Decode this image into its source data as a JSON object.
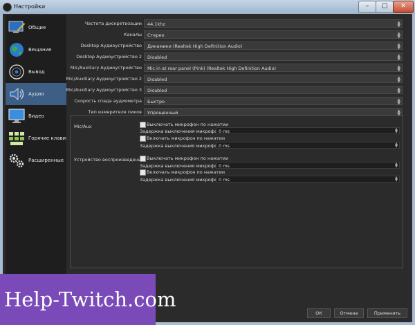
{
  "window": {
    "title": "Настройки",
    "minimize": "–",
    "maximize": "□",
    "close": "✕"
  },
  "sidebar": {
    "items": [
      {
        "label": "Общие",
        "icon": "monitor-pencil-icon"
      },
      {
        "label": "Вещание",
        "icon": "globe-icon"
      },
      {
        "label": "Вывод",
        "icon": "broadcast-icon"
      },
      {
        "label": "Аудио",
        "icon": "speaker-icon",
        "active": true
      },
      {
        "label": "Видео",
        "icon": "monitor-icon"
      },
      {
        "label": "Горячие клавиши",
        "icon": "keyboard-icon"
      },
      {
        "label": "Расширенные",
        "icon": "gears-icon"
      }
    ]
  },
  "settings": [
    {
      "label": "Частота дискретизации",
      "value": "44.1khz"
    },
    {
      "label": "Каналы",
      "value": "Стерео"
    },
    {
      "label": "Desktop Аудиоустройство",
      "value": "Динамики (Realtek High Definition Audio)"
    },
    {
      "label": "Desktop Аудиоустройство 2",
      "value": "Disabled"
    },
    {
      "label": "Mic/Auxiliary Аудиоустройство",
      "value": "Mic in at rear panel (Pink) (Realtek High Definition Audio)"
    },
    {
      "label": "Mic/Auxiliary Аудиоустройство 2",
      "value": "Disabled"
    },
    {
      "label": "Mic/Auxiliary Аудиоустройство 3",
      "value": "Disabled"
    },
    {
      "label": "Скорость спада аудиометра",
      "value": "Быстро"
    },
    {
      "label": "Тип измерителя пиков",
      "value": "Упрощенный"
    }
  ],
  "hotkeys": {
    "mic_aux": {
      "label": "Mic/Aux",
      "mute_checkbox": "Выключать микрофон по нажатии",
      "mute_delay_label": "Задержка выключения микрофона",
      "mute_delay_value": "0 ms",
      "unmute_checkbox": "Включать микрофон по нажатии",
      "unmute_delay_label": "Задержка выключения микрофона",
      "unmute_delay_value": "0 ms"
    },
    "playback": {
      "label": "Устройство воспроизведения",
      "mute_checkbox": "Выключать микрофон по нажатии",
      "mute_delay_label": "Задержка выключения микрофона",
      "mute_delay_value": "0 ms",
      "unmute_checkbox": "Включать микрофон по нажатии",
      "unmute_delay_label": "Задержка выключения микрофона",
      "unmute_delay_value": "0 ms"
    }
  },
  "buttons": {
    "ok": "ОК",
    "cancel": "Отмена",
    "apply": "Применить"
  },
  "watermark": {
    "text": "Help-Twitch.com"
  },
  "colors": {
    "active_item": "#3d5f86",
    "watermark_bg": "#7a4bb8"
  }
}
